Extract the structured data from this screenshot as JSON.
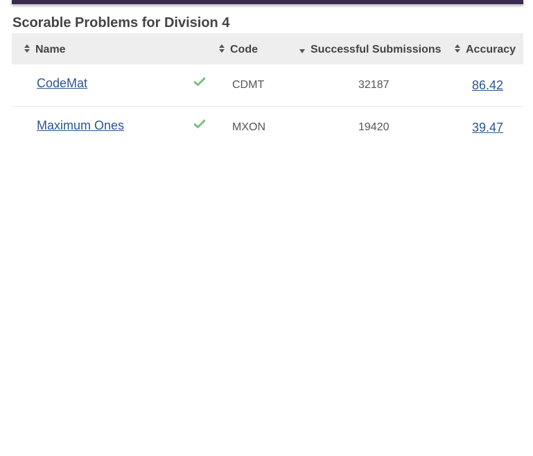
{
  "page": {
    "title": "Scorable Problems for Division 4"
  },
  "colors": {
    "top_bar": "#3a2a52",
    "link": "#2d5590",
    "check": "#7ac07a",
    "header_bg": "#eeeeee"
  },
  "table": {
    "columns": [
      {
        "label": "Name",
        "sort_icon": "sort-both-icon"
      },
      {
        "label": "Code",
        "sort_icon": "sort-both-icon"
      },
      {
        "label": "Successful Submissions",
        "sort_icon": "sort-desc-icon"
      },
      {
        "label": "Accuracy",
        "sort_icon": "sort-both-icon"
      }
    ],
    "rows": [
      {
        "name": "CodeMat",
        "solved_icon": "check-icon",
        "code": "CDMT",
        "submissions": "32187",
        "accuracy": "86.42"
      },
      {
        "name": "Maximum Ones",
        "solved_icon": "check-icon",
        "code": "MXON",
        "submissions": "19420",
        "accuracy": "39.47"
      }
    ]
  }
}
